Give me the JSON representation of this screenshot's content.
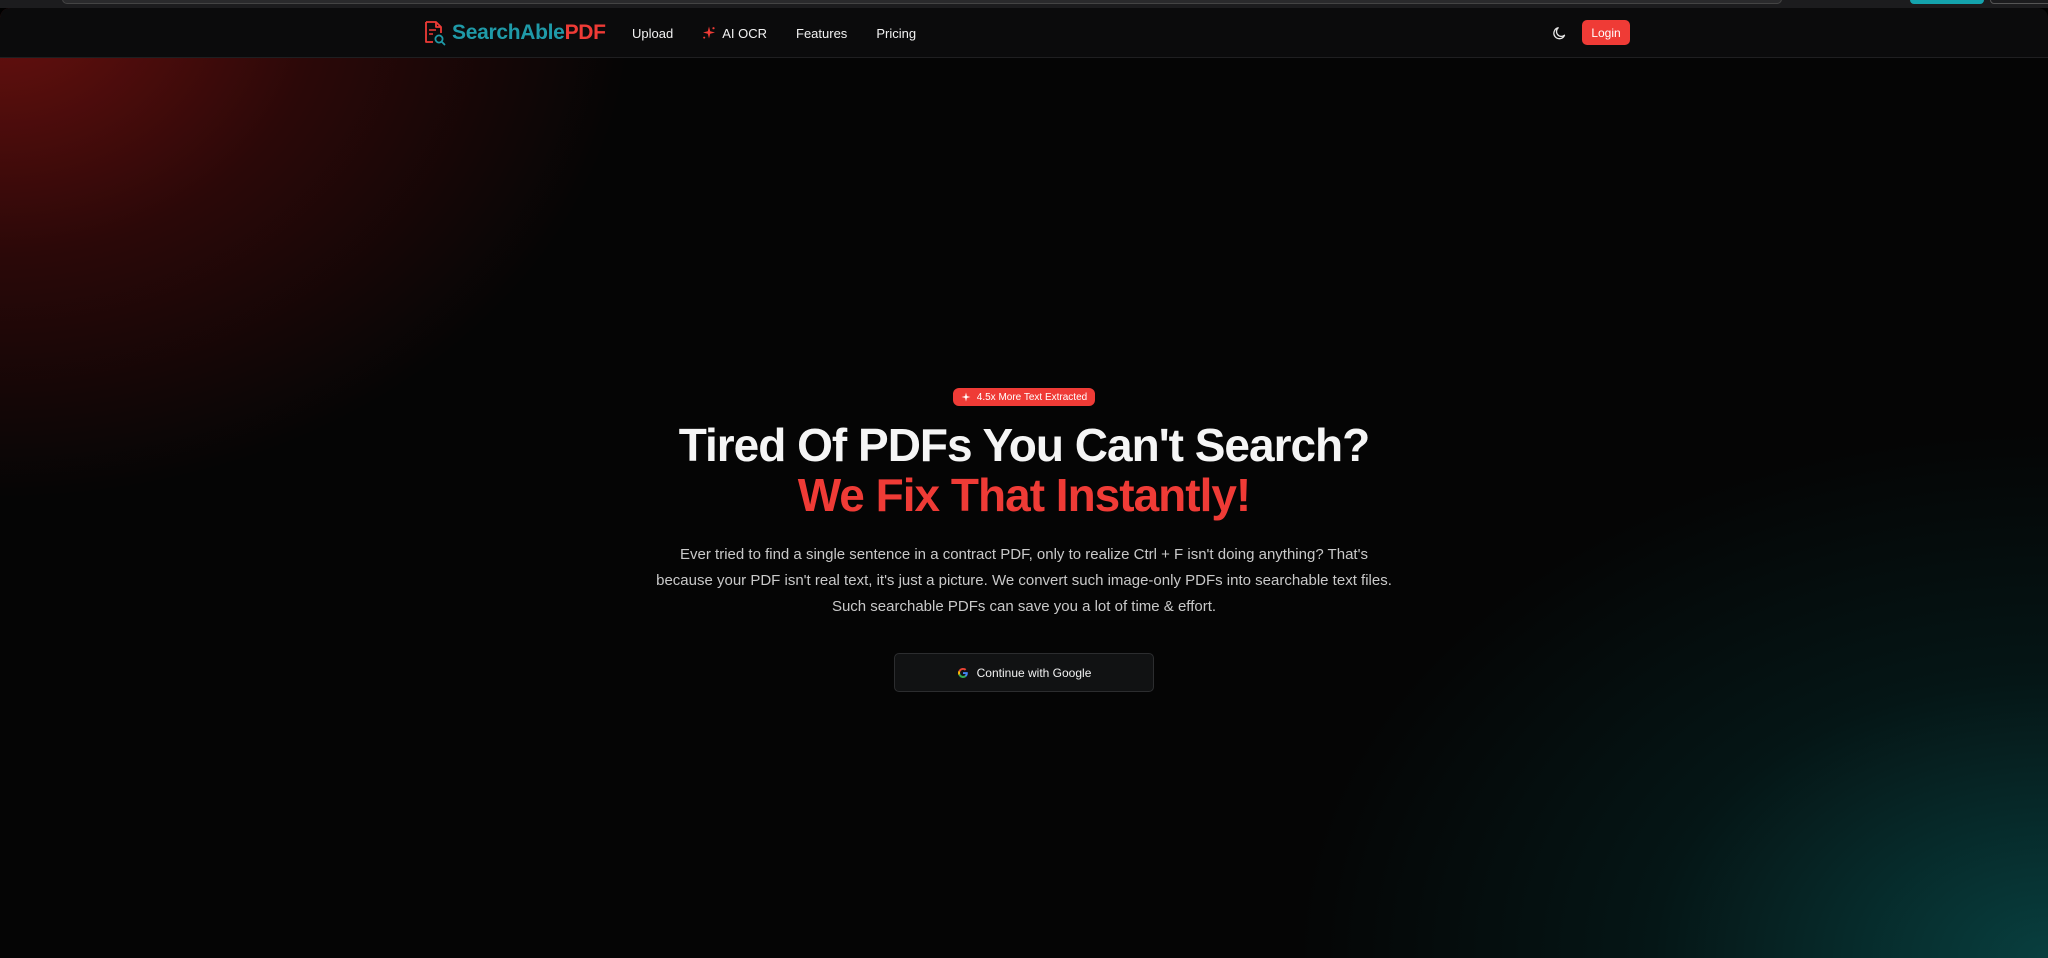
{
  "colors": {
    "brand_teal": "#1f9aa8",
    "brand_red": "#ef3b36",
    "background": "#050505"
  },
  "brand": {
    "name_part1": "SearchAble",
    "name_part2": "PDF",
    "logo_icon": "pdf-search-icon"
  },
  "nav": {
    "items": [
      {
        "label": "Upload"
      },
      {
        "label": "AI OCR",
        "icon": "sparkle-icon"
      },
      {
        "label": "Features"
      },
      {
        "label": "Pricing"
      }
    ],
    "theme_icon": "moon-icon",
    "login_label": "Login"
  },
  "hero": {
    "badge_icon": "sparkle-icon",
    "badge_text": "4.5x More Text Extracted",
    "headline_line1": "Tired Of PDFs You Can't Search?",
    "headline_line2": "We Fix That Instantly!",
    "description": "Ever tried to find a single sentence in a contract PDF, only to realize Ctrl + F isn't doing anything? That's because your PDF isn't real text, it's just a picture. We convert such image-only PDFs into searchable text files. Such searchable PDFs can save you a lot of time & effort.",
    "cta_icon": "google-icon",
    "cta_label": "Continue with Google"
  }
}
